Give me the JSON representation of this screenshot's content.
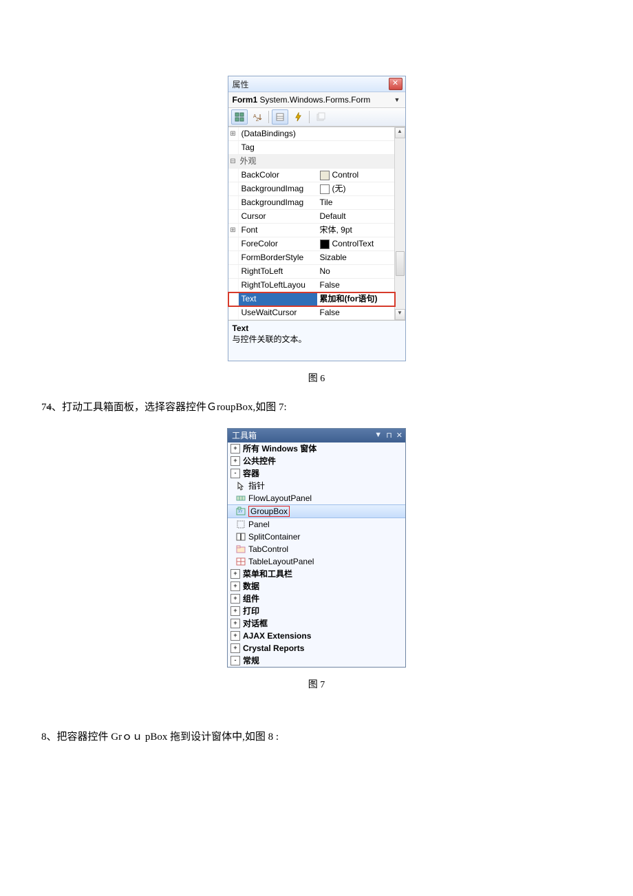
{
  "figure6": {
    "caption": "图 6",
    "window_title": "属性",
    "object_selector": {
      "name": "Form1",
      "type": "System.Windows.Forms.Form"
    },
    "help": {
      "title": "Text",
      "desc": "与控件关联的文本。"
    },
    "rows": [
      {
        "kind": "row",
        "exp": "⊞",
        "name": "(DataBindings)",
        "val": ""
      },
      {
        "kind": "row",
        "exp": "",
        "name": "Tag",
        "val": ""
      },
      {
        "kind": "cat",
        "exp": "⊟",
        "name": "外观",
        "val": ""
      },
      {
        "kind": "row",
        "exp": "",
        "name": "BackColor",
        "val": "Control",
        "swatch": "control"
      },
      {
        "kind": "row",
        "exp": "",
        "name": "BackgroundImag",
        "val": "(无)",
        "swatch": "none"
      },
      {
        "kind": "row",
        "exp": "",
        "name": "BackgroundImag",
        "val": "Tile"
      },
      {
        "kind": "row",
        "exp": "",
        "name": "Cursor",
        "val": "Default"
      },
      {
        "kind": "row",
        "exp": "⊞",
        "name": "Font",
        "val": "宋体, 9pt"
      },
      {
        "kind": "row",
        "exp": "",
        "name": "ForeColor",
        "val": "ControlText",
        "swatch": "controltext"
      },
      {
        "kind": "row",
        "exp": "",
        "name": "FormBorderStyle",
        "val": "Sizable"
      },
      {
        "kind": "row",
        "exp": "",
        "name": "RightToLeft",
        "val": "No"
      },
      {
        "kind": "row",
        "exp": "",
        "name": "RightToLeftLayou",
        "val": "False"
      },
      {
        "kind": "row",
        "exp": "",
        "name": "Text",
        "val": "累加和(for语句)",
        "selected": true
      },
      {
        "kind": "row",
        "exp": "",
        "name": "UseWaitCursor",
        "val": "False"
      }
    ]
  },
  "para7": {
    "num": "7",
    "strike": "4",
    "text": "、打动工具箱面板，选择容器控件ＧroupBox,如图 7:"
  },
  "figure7": {
    "caption": "图 7",
    "window_title": "工具箱",
    "rows": [
      {
        "kind": "cat",
        "exp": "+",
        "label": "所有 Windows 窗体"
      },
      {
        "kind": "cat",
        "exp": "+",
        "label": "公共控件"
      },
      {
        "kind": "cat",
        "exp": "-",
        "label": "容器"
      },
      {
        "kind": "item",
        "icon": "pointer",
        "label": "指针"
      },
      {
        "kind": "item",
        "icon": "flow",
        "label": "FlowLayoutPanel"
      },
      {
        "kind": "item",
        "icon": "groupbox",
        "label": "GroupBox",
        "selected": true
      },
      {
        "kind": "item",
        "icon": "panel",
        "label": "Panel"
      },
      {
        "kind": "item",
        "icon": "split",
        "label": "SplitContainer"
      },
      {
        "kind": "item",
        "icon": "tab",
        "label": "TabControl"
      },
      {
        "kind": "item",
        "icon": "table",
        "label": "TableLayoutPanel"
      },
      {
        "kind": "cat",
        "exp": "+",
        "label": "菜单和工具栏"
      },
      {
        "kind": "cat",
        "exp": "+",
        "label": "数据"
      },
      {
        "kind": "cat",
        "exp": "+",
        "label": "组件"
      },
      {
        "kind": "cat",
        "exp": "+",
        "label": "打印"
      },
      {
        "kind": "cat",
        "exp": "+",
        "label": "对话框"
      },
      {
        "kind": "cat",
        "exp": "+",
        "label": "AJAX Extensions"
      },
      {
        "kind": "cat",
        "exp": "+",
        "label": "Crystal Reports"
      },
      {
        "kind": "cat",
        "exp": "-",
        "label": "常规"
      }
    ]
  },
  "para8": "8、把容器控件 Grｏｕ pBox 拖到设计窗体中,如图 8 :"
}
